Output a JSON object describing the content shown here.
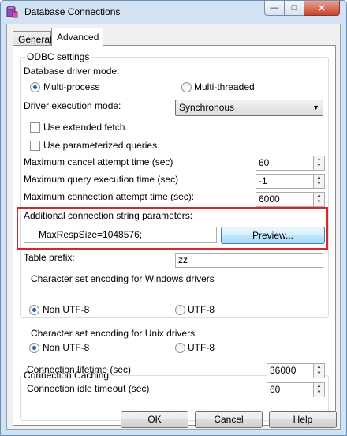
{
  "window": {
    "title": "Database Connections",
    "icon": "database-icon"
  },
  "title_buttons": {
    "minimize": "—",
    "maximize": "□",
    "close": "✕"
  },
  "tabs": [
    {
      "label": "General"
    },
    {
      "label": "Advanced"
    }
  ],
  "odbc": {
    "group_title": "ODBC settings",
    "driver_mode_label": "Database driver mode:",
    "multi_process": "Multi-process",
    "multi_threaded": "Multi-threaded",
    "exec_mode_label": "Driver execution mode:",
    "exec_mode_value": "Synchronous",
    "extended_fetch": "Use extended fetch.",
    "parameterized": "Use parameterized queries.",
    "max_cancel_label": "Maximum cancel attempt time (sec)",
    "max_cancel_value": "60",
    "max_query_label": "Maximum query execution time (sec)",
    "max_query_value": "-1",
    "max_conn_label": "Maximum connection attempt time (sec):",
    "max_conn_value": "6000",
    "additional_label": "Additional connection string parameters:",
    "additional_value": "MaxRespSize=1048576;",
    "preview_button": "Preview...",
    "table_prefix_label": "Table prefix:",
    "table_prefix_value": "zz"
  },
  "windows_encoding": {
    "group_title": "Character set encoding for Windows drivers",
    "non_utf8": "Non UTF-8",
    "utf8": "UTF-8"
  },
  "unix_encoding": {
    "group_title": "Character set encoding for Unix drivers",
    "non_utf8": "Non UTF-8",
    "utf8": "UTF-8"
  },
  "caching": {
    "group_title": "Connection Caching",
    "lifetime_label": "Connection lifetime (sec)",
    "lifetime_value": "36000",
    "idle_label": "Connection idle timeout (sec)",
    "idle_value": "60"
  },
  "footer": {
    "ok": "OK",
    "cancel": "Cancel",
    "help": "Help"
  },
  "colors": {
    "highlight": "#d9262b",
    "title_bar": "#d3e2f2",
    "close_button": "#c9452d"
  }
}
